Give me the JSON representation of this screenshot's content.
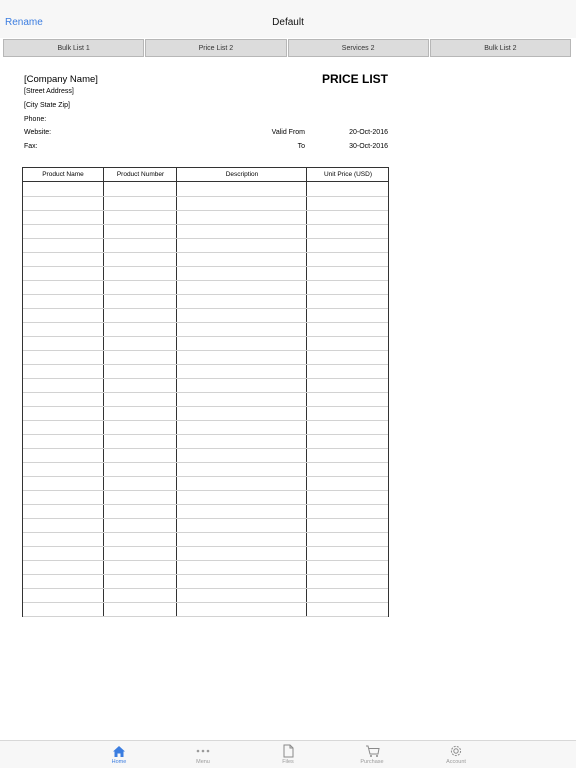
{
  "navbar": {
    "left_action": "Rename",
    "title": "Default"
  },
  "sheet_tabs": [
    {
      "label": "Bulk List 1"
    },
    {
      "label": "Price List 2"
    },
    {
      "label": "Services 2"
    },
    {
      "label": "Bulk List 2"
    }
  ],
  "document": {
    "company_name": "[Company Name]",
    "title": "PRICE LIST",
    "street": "[Street Address]",
    "city": "[City State Zip]",
    "phone_label": "Phone:",
    "website_label": "Website:",
    "fax_label": "Fax:",
    "valid_from_label": "Valid From",
    "valid_from": "20-Oct-2016",
    "to_label": "To",
    "to": "30-Oct-2016",
    "columns": [
      "Product Name",
      "Product Number",
      "Description",
      "Unit Price (USD)"
    ],
    "empty_rows": 31
  },
  "tabbar": [
    {
      "label": "Home",
      "icon": "home-icon",
      "active": true
    },
    {
      "label": "Menu",
      "icon": "more-dots-icon",
      "active": false
    },
    {
      "label": "Files",
      "icon": "file-icon",
      "active": false
    },
    {
      "label": "Purchase",
      "icon": "cart-icon",
      "active": false
    },
    {
      "label": "Account",
      "icon": "gear-icon",
      "active": false
    }
  ],
  "colors": {
    "accent": "#3b7de0",
    "inactive": "#9a9a9a"
  }
}
